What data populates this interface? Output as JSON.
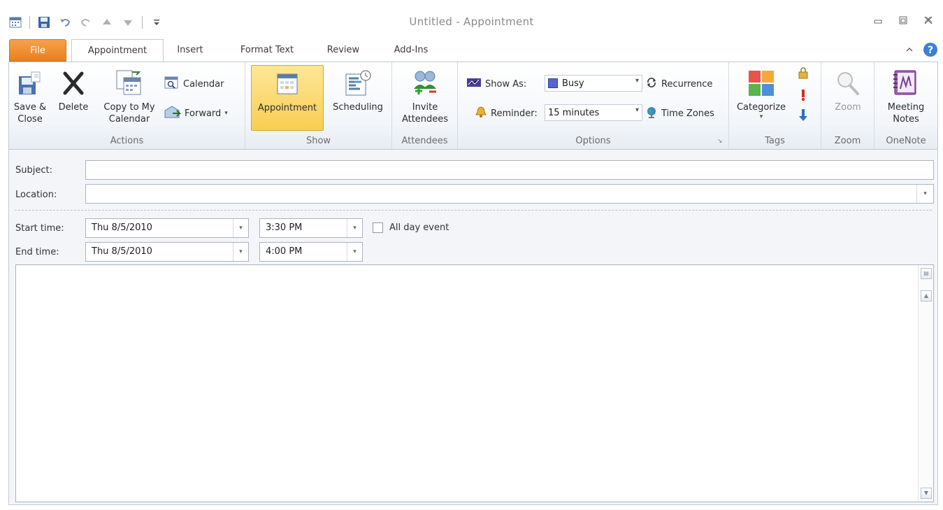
{
  "window": {
    "title": "Untitled - Appointment"
  },
  "tabs": [
    {
      "label": "File"
    },
    {
      "label": "Appointment"
    },
    {
      "label": "Insert"
    },
    {
      "label": "Format Text"
    },
    {
      "label": "Review"
    },
    {
      "label": "Add-Ins"
    }
  ],
  "ribbon": {
    "actions": {
      "save_close": "Save & Close",
      "save_close_l1": "Save &",
      "save_close_l2": "Close",
      "delete": "Delete",
      "copy_l1": "Copy to My",
      "copy_l2": "Calendar",
      "calendar": "Calendar",
      "forward": "Forward",
      "group": "Actions"
    },
    "show": {
      "appointment": "Appointment",
      "scheduling": "Scheduling",
      "group": "Show"
    },
    "attendees": {
      "invite_l1": "Invite",
      "invite_l2": "Attendees",
      "group": "Attendees"
    },
    "options": {
      "show_as_label": "Show As:",
      "show_as_value": "Busy",
      "reminder_label": "Reminder:",
      "reminder_value": "15 minutes",
      "recurrence": "Recurrence",
      "time_zones": "Time Zones",
      "group": "Options"
    },
    "tags": {
      "categorize": "Categorize",
      "group": "Tags"
    },
    "zoom": {
      "zoom": "Zoom",
      "group": "Zoom"
    },
    "onenote": {
      "notes_l1": "Meeting",
      "notes_l2": "Notes",
      "group": "OneNote"
    }
  },
  "form": {
    "subject_label": "Subject:",
    "location_label": "Location:",
    "start_label": "Start time:",
    "end_label": "End time:",
    "start_date": "Thu 8/5/2010",
    "start_time": "3:30 PM",
    "end_date": "Thu 8/5/2010",
    "end_time": "4:00 PM",
    "all_day": "All day event"
  },
  "colors": {
    "file_tab": "#e97f1e",
    "selected_button": "#f9cd52",
    "busy": "#5566cc",
    "ribbon_border": "#c2cad6"
  }
}
